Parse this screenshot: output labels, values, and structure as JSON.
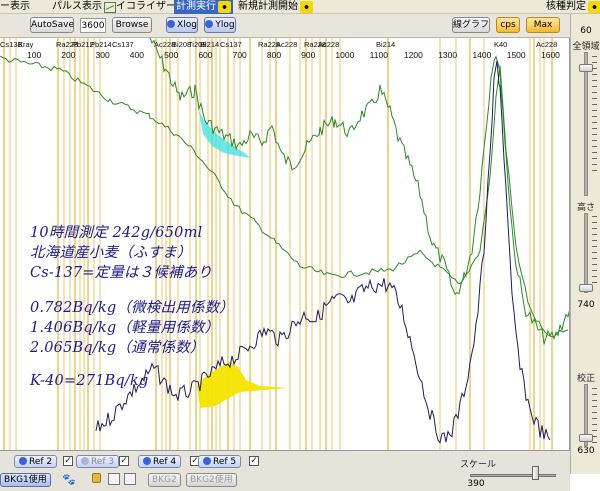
{
  "menubar": {
    "items": [
      {
        "label": "ー表示",
        "icon": ""
      },
      {
        "label": "パルス表示",
        "icon": "pulse-chart-icon"
      },
      {
        "label": "イコライザー",
        "icon": "equalizer-chart-icon"
      },
      {
        "label": "計測実行",
        "icon": "radiation-icon"
      },
      {
        "label": "新規計測開始",
        "icon": "radiation-icon"
      },
      {
        "label": "核種判定",
        "icon": "radiation-icon"
      }
    ]
  },
  "toolbar": {
    "autosave_label": "AutoSave",
    "interval_value": "3600",
    "browse_label": "Browse",
    "xlog_label": "Xlog",
    "ylog_label": "Ylog",
    "line_graph_label": "線グラフ",
    "cps_label": "cps",
    "max_label": "Max"
  },
  "right_panel": {
    "top_value": "60",
    "full_range_label": "全領域",
    "height_label": "高さ",
    "height_value": "740",
    "correction_label": "校正",
    "correction_value": "630"
  },
  "spectrum": {
    "peak_labels": [
      "Cs13B",
      "Xray",
      "Ra228",
      "Pb212",
      "Pb214",
      "Cs137",
      "Ac228",
      "Bi208",
      "Ti208",
      "Bi214",
      "Cs137",
      "Ra228",
      "Ac228",
      "Ra228",
      "Ac228",
      "Bi214",
      "K40",
      "Ac228"
    ],
    "energy_ticks": [
      "100",
      "200",
      "300",
      "400",
      "500",
      "600",
      "700",
      "800",
      "900",
      "1000",
      "1100",
      "1200",
      "1300",
      "1400",
      "1500",
      "1600"
    ]
  },
  "annotation": {
    "line1": "10時間測定  242g/650ml",
    "line2": "北海道産小麦（ふすま）",
    "line3": "Cs-137=定量は３候補あり",
    "line4": "0.782Bq/kg（微検出用係数）",
    "line5": "1.406Bq/kg（軽量用係数）",
    "line6": "2.065Bq/kg（通常係数）",
    "line7": "K-40=271Bq/kg"
  },
  "bottom": {
    "refs": [
      "Ref 2",
      "Ref 3",
      "Ref 4",
      "Ref 5"
    ],
    "bkg1_label": "BKG1使用",
    "bkg2_label": "BKG2",
    "bkg2_use_label": "BKG2使用",
    "scale_label": "スケール",
    "scale_value": "390"
  },
  "colors": {
    "energy_line": "#e8b84a",
    "sample_spectrum": "#1e1e5a",
    "reference_spectrum": "#2a8a2a",
    "cs137_region_top": "#3ee0e0",
    "cs137_region_bottom": "#f4e400",
    "annotation_text": "#1a1a8a"
  }
}
